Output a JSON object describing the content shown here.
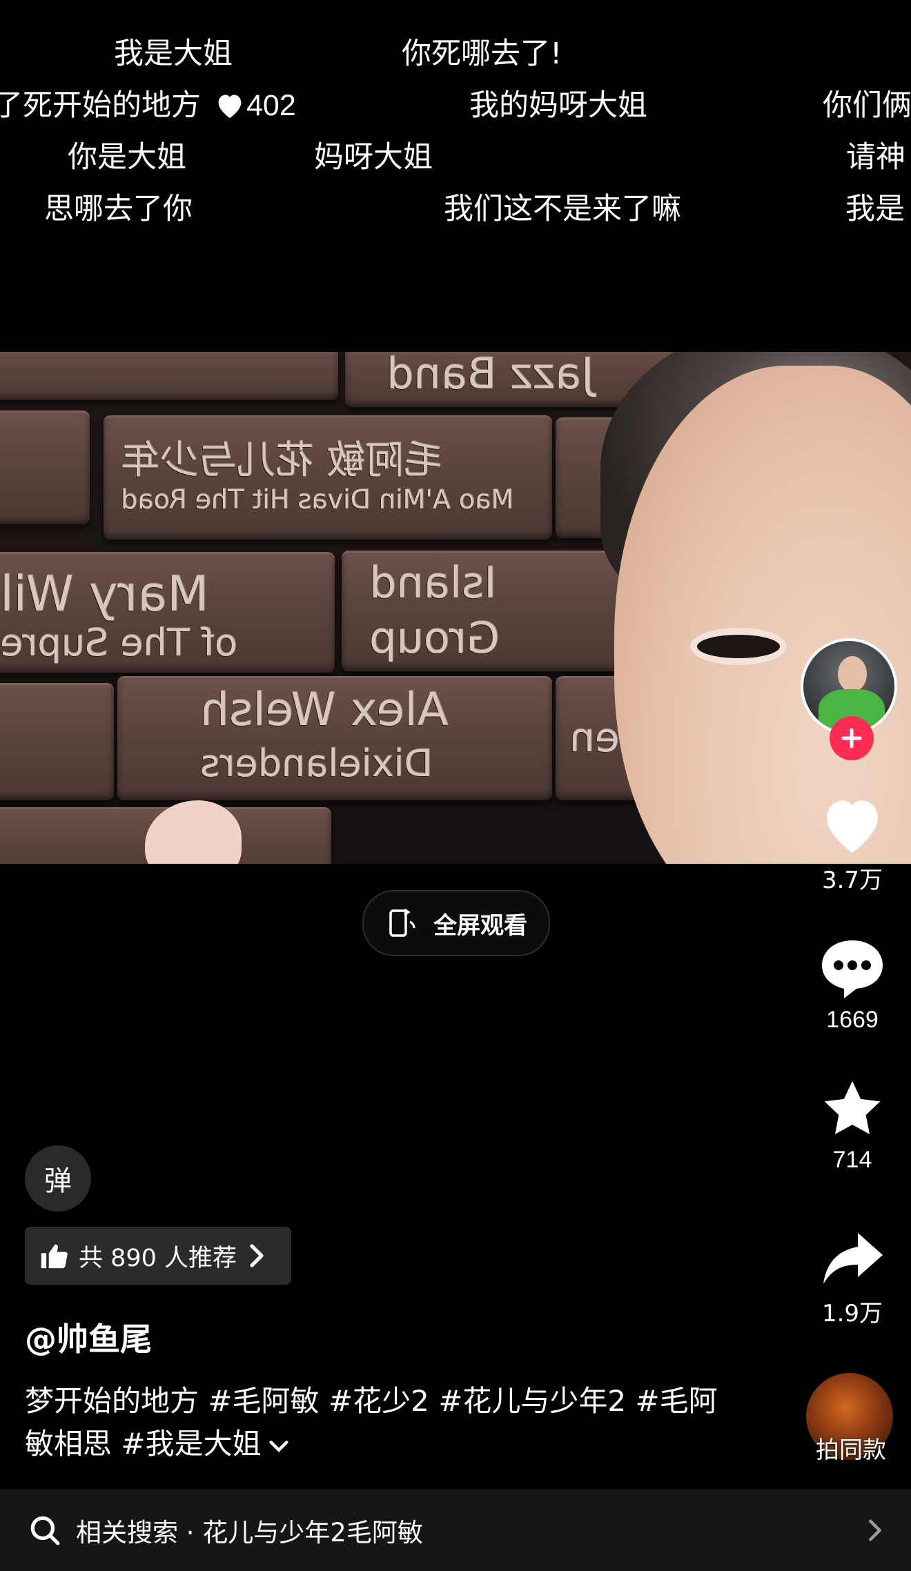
{
  "danmaku": [
    {
      "text": "我是大姐"
    },
    {
      "text": "你死哪去了!"
    },
    {
      "text": "了死开始的地方",
      "likes": "402"
    },
    {
      "text": "我的妈呀大姐"
    },
    {
      "text": "你们俩"
    },
    {
      "text": "你是大姐"
    },
    {
      "text": "妈呀大姐"
    },
    {
      "text": "请神"
    },
    {
      "text": "思哪去了你"
    },
    {
      "text": "我们这不是来了嘛"
    },
    {
      "text": "我是"
    }
  ],
  "video": {
    "fullscreen_label": "全屏观看",
    "bricks": [
      "Jazz Band",
      "毛阿敏 花儿与少年",
      "Mao A'Min Divas Hit The Road",
      "Mary Wil",
      "of The Supre",
      "Island",
      "Group",
      "Alex Welsh",
      "Dixielanders",
      "Men"
    ]
  },
  "sidebar": {
    "like_count": "3.7万",
    "comment_count": "1669",
    "favorite_count": "714",
    "share_count": "1.9万",
    "music_label": "拍同款"
  },
  "danmu_toggle_label": "弹",
  "recommend": {
    "label": "共 890 人推荐"
  },
  "author": {
    "handle": "@帅鱼尾"
  },
  "caption": {
    "prefix": "梦开始的地方 ",
    "tags": [
      "#毛阿敏",
      "#花少2",
      "#花儿与少年2",
      "#毛阿敏相思",
      "#我是大姐"
    ]
  },
  "related_search": {
    "label": "相关搜索 · 花儿与少年2毛阿敏"
  },
  "colors": {
    "accent": "#fe2c55",
    "background": "#000000"
  }
}
